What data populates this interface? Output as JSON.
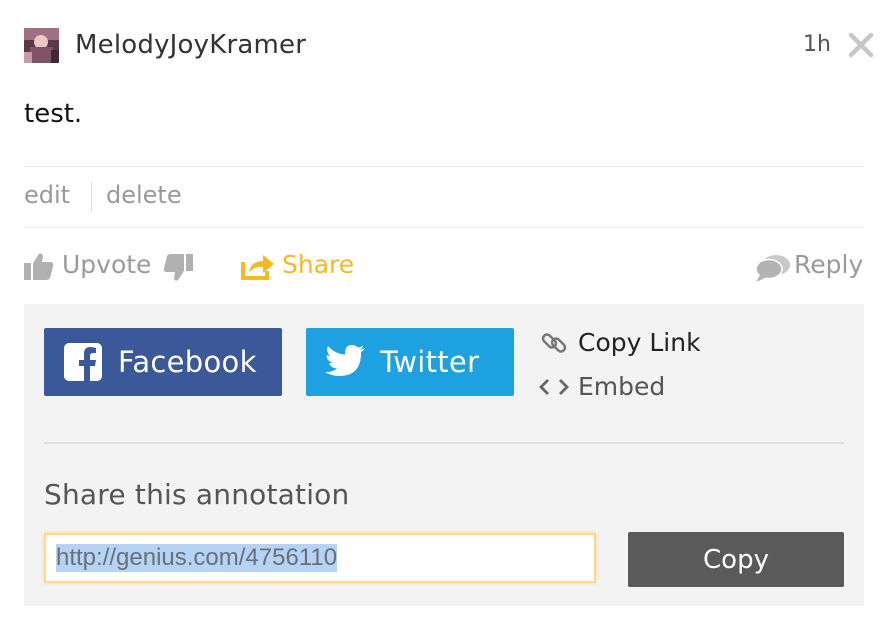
{
  "header": {
    "username": "MelodyJoyKramer",
    "time": "1h"
  },
  "annotation": {
    "text": "test."
  },
  "moderation": {
    "edit": "edit",
    "delete": "delete"
  },
  "actions": {
    "upvote": "Upvote",
    "share": "Share",
    "reply": "Reply"
  },
  "share_panel": {
    "facebook": "Facebook",
    "twitter": "Twitter",
    "copy_link": "Copy Link",
    "embed": "Embed",
    "title": "Share this annotation",
    "url": "http://genius.com/4756110",
    "copy_button": "Copy"
  },
  "colors": {
    "facebook": "#3b5998",
    "twitter": "#1da1e1",
    "share_accent": "#f5b921",
    "copy_button": "#5a5a5a"
  }
}
